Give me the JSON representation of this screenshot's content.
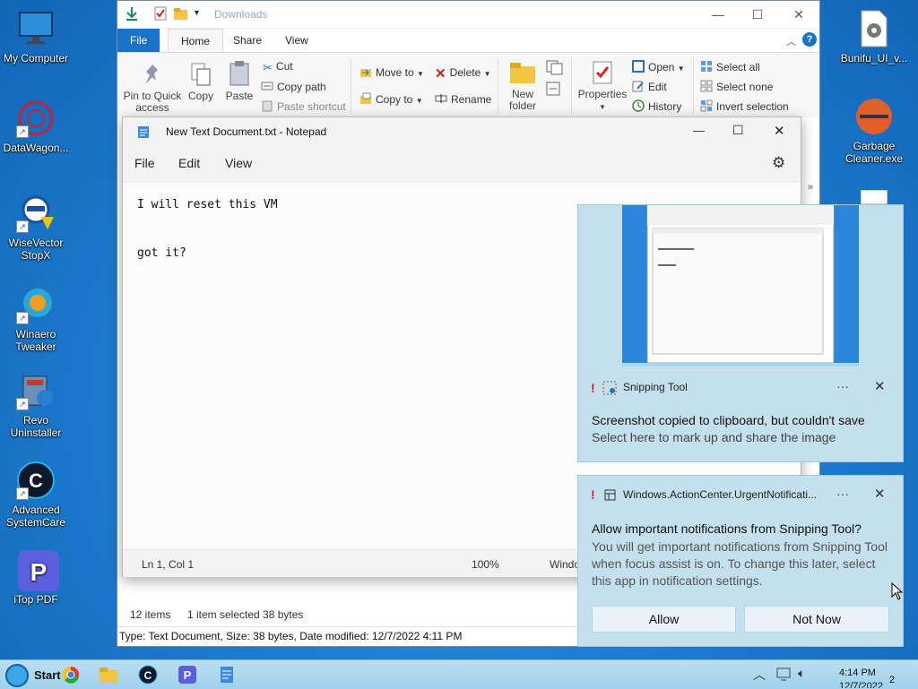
{
  "desktop": {
    "icons": [
      {
        "label": "My Computer"
      },
      {
        "label": "DataWagon..."
      },
      {
        "label": "WiseVector StopX"
      },
      {
        "label": "Winaero Tweaker"
      },
      {
        "label": "Revo Uninstaller"
      },
      {
        "label": "Advanced SystemCare"
      },
      {
        "label": "iTop PDF"
      },
      {
        "label": "Bunifu_UI_v..."
      },
      {
        "label": "Garbage Cleaner.exe"
      }
    ]
  },
  "explorer": {
    "title": "Downloads",
    "tabs": [
      "File",
      "Home",
      "Share",
      "View"
    ],
    "ribbon": {
      "pin": "Pin to Quick access",
      "copy": "Copy",
      "paste": "Paste",
      "cut": "Cut",
      "copy_path": "Copy path",
      "paste_shortcut": "Paste shortcut",
      "move_to": "Move to",
      "copy_to": "Copy to",
      "delete": "Delete",
      "rename": "Rename",
      "new_folder": "New folder",
      "properties": "Properties",
      "open": "Open",
      "edit": "Edit",
      "history": "History",
      "select_all": "Select all",
      "select_none": "Select none",
      "invert_selection": "Invert selection"
    },
    "status_items": "12 items",
    "status_selected": "1 item selected  38 bytes",
    "details": "Type: Text Document, Size: 38 bytes, Date modified: 12/7/2022 4:11 PM"
  },
  "notepad": {
    "title": "New Text Document.txt - Notepad",
    "menu": [
      "File",
      "Edit",
      "View"
    ],
    "lines": [
      "I will reset this VM",
      "",
      "got it?"
    ],
    "status": {
      "position": "Ln 1, Col 1",
      "zoom": "100%",
      "encoding_partial": "Windo"
    }
  },
  "toast1": {
    "app": "Snipping Tool",
    "title": "Screenshot copied to clipboard, but couldn't save",
    "body": "Select here to mark up and share the image"
  },
  "toast2": {
    "app": "Windows.ActionCenter.UrgentNotificati...",
    "title": "Allow important notifications from Snipping Tool?",
    "body": "You will get important notifications from Snipping Tool when focus assist is on. To change this later, select this app in notification settings.",
    "allow": "Allow",
    "not_now": "Not Now"
  },
  "taskbar": {
    "start": "Start",
    "time": "4:14 PM",
    "date_partial": "12/7/2022",
    "badge": "2"
  },
  "colors": {
    "accent": "#1a73c8",
    "toast_bg": "#c3e0ec",
    "taskbar": "#a9d8ef"
  }
}
